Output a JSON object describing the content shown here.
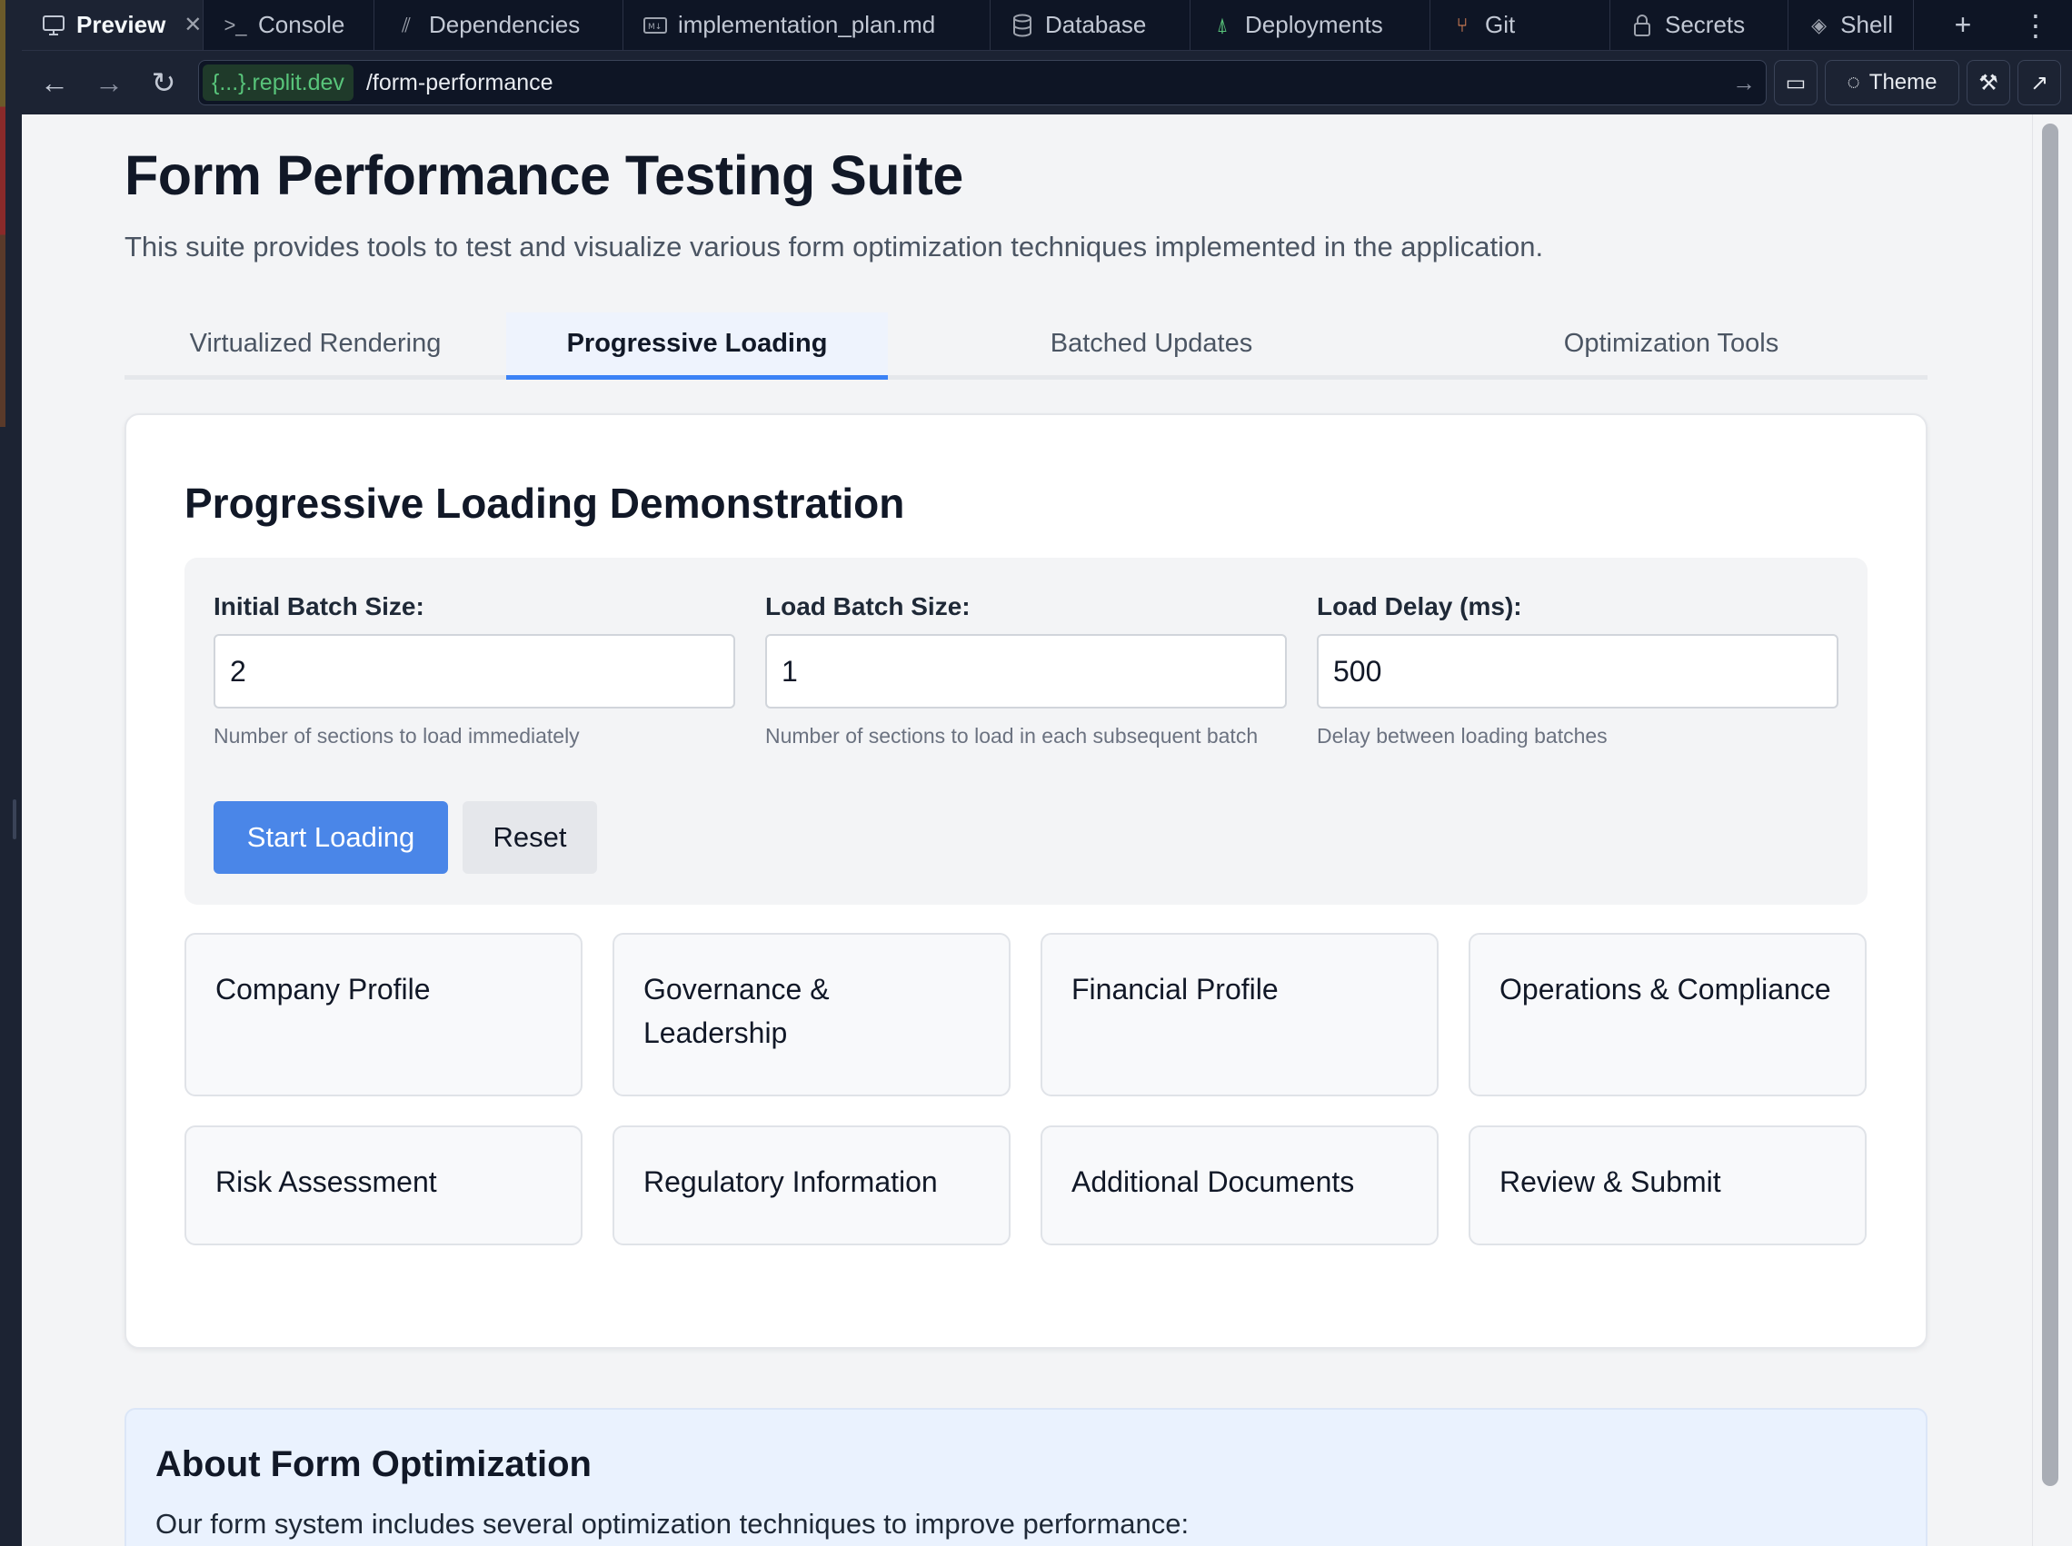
{
  "ide_tabs": [
    {
      "label": "Preview",
      "icon": "monitor-icon",
      "active": true
    },
    {
      "label": "Console",
      "icon": "terminal-icon"
    },
    {
      "label": "Dependencies",
      "icon": "dependencies-icon"
    },
    {
      "label": "implementation_plan.md",
      "icon": "markdown-icon"
    },
    {
      "label": "Database",
      "icon": "database-icon"
    },
    {
      "label": "Deployments",
      "icon": "deployments-icon"
    },
    {
      "label": "Git",
      "icon": "git-icon"
    },
    {
      "label": "Secrets",
      "icon": "lock-icon"
    },
    {
      "label": "Shell",
      "icon": "shell-icon"
    }
  ],
  "url_bar": {
    "host": "{...}.replit.dev",
    "path": "/form-performance",
    "theme_label": "Theme"
  },
  "page": {
    "title": "Form Performance Testing Suite",
    "lead": "This suite provides tools to test and visualize various form optimization techniques implemented in the application.",
    "tabs": [
      {
        "label": "Virtualized Rendering"
      },
      {
        "label": "Progressive Loading",
        "active": true
      },
      {
        "label": "Batched Updates"
      },
      {
        "label": "Optimization Tools"
      }
    ]
  },
  "demo": {
    "heading": "Progressive Loading Demonstration",
    "fields": [
      {
        "label": "Initial Batch Size:",
        "value": "2",
        "help": "Number of sections to load immediately"
      },
      {
        "label": "Load Batch Size:",
        "value": "1",
        "help": "Number of sections to load in each subsequent batch"
      },
      {
        "label": "Load Delay (ms):",
        "value": "500",
        "help": "Delay between loading batches"
      }
    ],
    "start_label": "Start Loading",
    "reset_label": "Reset",
    "sections": [
      "Company Profile",
      "Governance & Leadership",
      "Financial Profile",
      "Operations & Compliance",
      "Risk Assessment",
      "Regulatory Information",
      "Additional Documents",
      "Review & Submit"
    ]
  },
  "about": {
    "heading": "About Form Optimization",
    "text": "Our form system includes several optimization techniques to improve performance:"
  },
  "colors": {
    "accent": "#3b82f6",
    "primary_button": "#4a86e8",
    "ide_bg": "#0e1525",
    "page_bg": "#f3f4f6"
  }
}
